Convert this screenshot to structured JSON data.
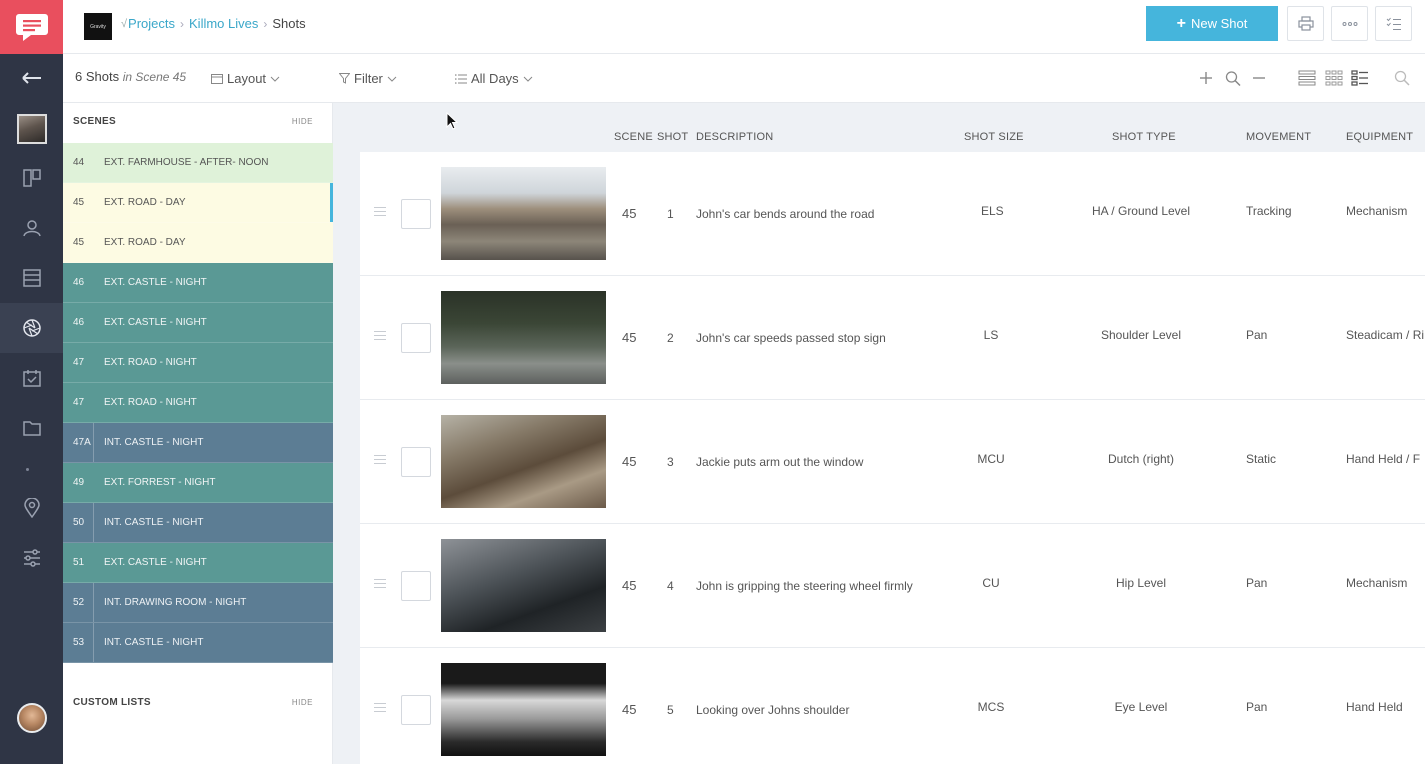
{
  "header": {
    "project_logo_text": "Gravity",
    "breadcrumb": [
      {
        "label": "Projects"
      },
      {
        "label": "Killmo Lives"
      },
      {
        "label": "Shots"
      }
    ],
    "new_shot_label": "New Shot"
  },
  "toolbar": {
    "shot_count": "6 Shots",
    "scene_context": "in Scene 45",
    "layout_label": "Layout",
    "filter_label": "Filter",
    "days_label": "All Days"
  },
  "scenes_panel": {
    "title": "SCENES",
    "hide_label": "HIDE",
    "custom_lists_title": "CUSTOM LISTS",
    "custom_lists_hide": "HIDE",
    "items": [
      {
        "num": "44",
        "label": "EXT. FARMHOUSE - AFTER- NOON",
        "color": "#dff2d9"
      },
      {
        "num": "45",
        "label": "EXT. ROAD - DAY",
        "color": "#fdfbe3",
        "selected": true
      },
      {
        "num": "45",
        "label": "EXT. ROAD - DAY",
        "color": "#fdfbe3"
      },
      {
        "num": "46",
        "label": "EXT. CASTLE - NIGHT",
        "color": "#5a9995"
      },
      {
        "num": "46",
        "label": "EXT. CASTLE - NIGHT",
        "color": "#5a9995"
      },
      {
        "num": "47",
        "label": "EXT. ROAD - NIGHT",
        "color": "#5a9995"
      },
      {
        "num": "47",
        "label": "EXT. ROAD - NIGHT",
        "color": "#5a9995"
      },
      {
        "num": "47A",
        "label": "INT. CASTLE - NIGHT",
        "color": "#5c7d94"
      },
      {
        "num": "49",
        "label": "EXT. FORREST - NIGHT",
        "color": "#5a9995"
      },
      {
        "num": "50",
        "label": "INT. CASTLE - NIGHT",
        "color": "#5c7d94"
      },
      {
        "num": "51",
        "label": "EXT. CASTLE - NIGHT",
        "color": "#5a9995"
      },
      {
        "num": "52",
        "label": "INT. DRAWING ROOM - NIGHT",
        "color": "#5c7d94"
      },
      {
        "num": "53",
        "label": "INT. CASTLE - NIGHT",
        "color": "#5c7d94"
      }
    ]
  },
  "table": {
    "columns": {
      "scene": "SCENE",
      "shot": "SHOT",
      "description": "DESCRIPTION",
      "shot_size": "SHOT SIZE",
      "shot_type": "SHOT TYPE",
      "movement": "MOVEMENT",
      "equipment": "EQUIPMENT"
    },
    "rows": [
      {
        "scene": "45",
        "shot": "1",
        "description": "John's car bends around the road",
        "shot_size": "ELS",
        "shot_type": "HA / Ground Level",
        "movement": "Tracking",
        "equipment": "Mechanism"
      },
      {
        "scene": "45",
        "shot": "2",
        "description": "John's car speeds passed stop sign",
        "shot_size": "LS",
        "shot_type": "Shoulder Level",
        "movement": "Pan",
        "equipment": "Steadicam / Ri"
      },
      {
        "scene": "45",
        "shot": "3",
        "description": "Jackie puts arm out the window",
        "shot_size": "MCU",
        "shot_type": "Dutch (right)",
        "movement": "Static",
        "equipment": "Hand Held / F"
      },
      {
        "scene": "45",
        "shot": "4",
        "description": "John is gripping the steering wheel firmly",
        "shot_size": "CU",
        "shot_type": "Hip Level",
        "movement": "Pan",
        "equipment": "Mechanism"
      },
      {
        "scene": "45",
        "shot": "5",
        "description": "Looking over Johns shoulder",
        "shot_size": "MCS",
        "shot_type": "Eye Level",
        "movement": "Pan",
        "equipment": "Hand Held"
      }
    ]
  },
  "colors": {
    "brand_red": "#e94f5e",
    "accent_blue": "#45b5dc",
    "rail_bg": "#2f3545"
  }
}
